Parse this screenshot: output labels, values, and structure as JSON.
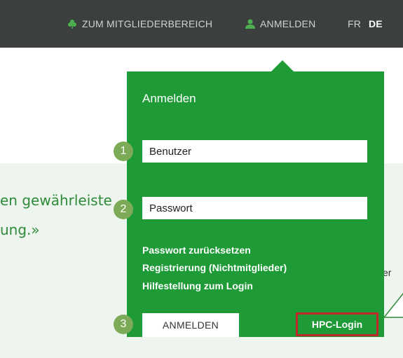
{
  "topbar": {
    "members_label": "ZUM MITGLIEDERBEREICH",
    "members_icon": "clover-icon",
    "login_label": "ANMELDEN",
    "login_icon": "user-icon",
    "languages": [
      "FR",
      "DE"
    ],
    "active_language": "DE"
  },
  "background": {
    "quote_line1": "en gewährleiste",
    "quote_line2": "ung.»",
    "fragment": "er"
  },
  "login": {
    "title": "Anmelden",
    "username_placeholder": "Benutzer",
    "password_placeholder": "Passwort",
    "links": [
      "Passwort zurücksetzen",
      "Registrierung (Nichtmitglieder)",
      "Hilfestellung zum Login"
    ],
    "submit_label": "ANMELDEN",
    "hpc_label": "HPC-Login"
  },
  "markers": [
    "1",
    "2",
    "3"
  ],
  "colors": {
    "topbar": "#3b3f3d",
    "panel": "#1e9a36",
    "marker": "#7daa57",
    "highlight": "#c0282a",
    "quote": "#2e8b3a"
  }
}
